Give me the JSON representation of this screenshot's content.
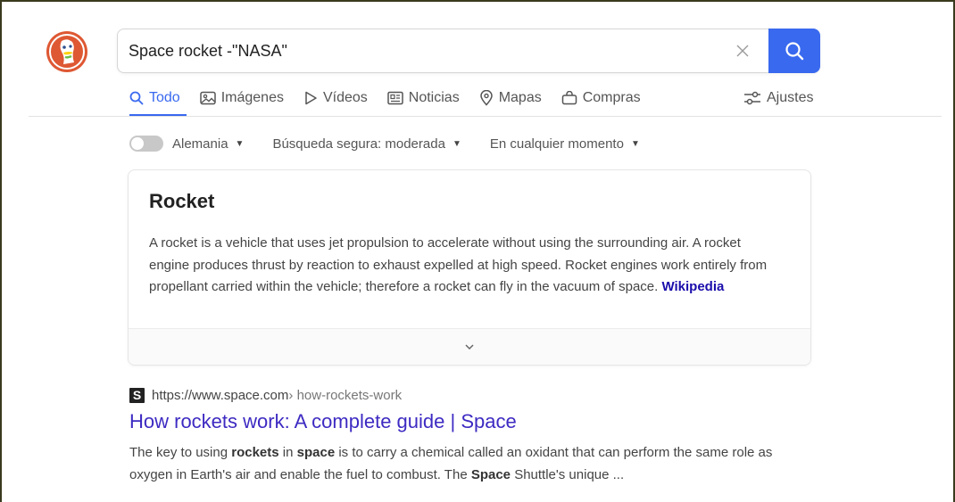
{
  "search": {
    "query": "Space rocket -\"NASA\""
  },
  "tabs": [
    {
      "label": "Todo",
      "icon": "search-icon",
      "active": true
    },
    {
      "label": "Imágenes",
      "icon": "image-icon"
    },
    {
      "label": "Vídeos",
      "icon": "play-icon"
    },
    {
      "label": "Noticias",
      "icon": "news-icon"
    },
    {
      "label": "Mapas",
      "icon": "map-pin-icon"
    },
    {
      "label": "Compras",
      "icon": "shopping-bag-icon"
    }
  ],
  "settings_label": "Ajustes",
  "filters": {
    "region": "Alemania",
    "safe_search": "Búsqueda segura: moderada",
    "time": "En cualquier momento"
  },
  "knowledge_card": {
    "title": "Rocket",
    "text": "A rocket is a vehicle that uses jet propulsion to accelerate without using the surrounding air. A rocket engine produces thrust by reaction to exhaust expelled at high speed. Rocket engines work entirely from propellant carried within the vehicle; therefore a rocket can fly in the vacuum of space.",
    "source_link": "Wikipedia"
  },
  "result": {
    "favicon_letter": "S",
    "url_domain": "https://www.space.com",
    "url_path": " › how-rockets-work",
    "title": "How rockets work: A complete guide | Space",
    "snippet_parts": [
      "The key to using ",
      "rockets",
      " in ",
      "space",
      " is to carry a chemical called an oxidant that can perform the same role as oxygen in Earth's air and enable the fuel to combust. The ",
      "Space",
      " Shuttle's unique ..."
    ]
  },
  "colors": {
    "accent": "#3969ef",
    "link": "#3d2bc2",
    "logo_orange": "#de5833"
  }
}
